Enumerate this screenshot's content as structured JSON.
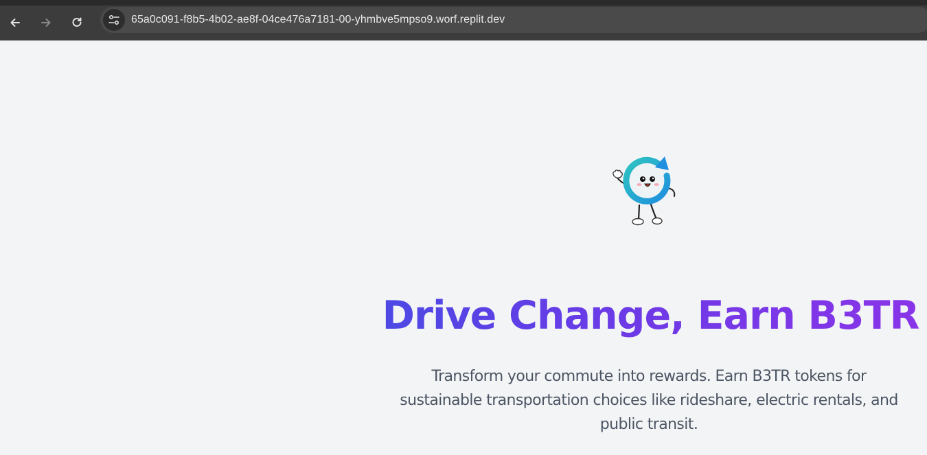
{
  "browser": {
    "url": "65a0c091-f8b5-4b02-ae8f-04ce476a7181-00-yhmbve5mpso9.worf.replit.dev",
    "icons": {
      "back": "arrow-left-icon",
      "forward": "arrow-right-icon",
      "reload": "reload-icon",
      "site_info": "tune-icon"
    }
  },
  "hero": {
    "mascot": "recycle-mascot-icon",
    "title": "Drive Change, Earn B3TR",
    "subtitle": "Transform your commute into rewards. Earn B3TR tokens for sustainable transportation choices like rideshare, electric rentals, and public transit.",
    "colors": {
      "gradient_start": "#2f5be6",
      "gradient_end": "#8a34e8",
      "subtitle": "#4b5563",
      "background": "#f3f4f6"
    }
  }
}
